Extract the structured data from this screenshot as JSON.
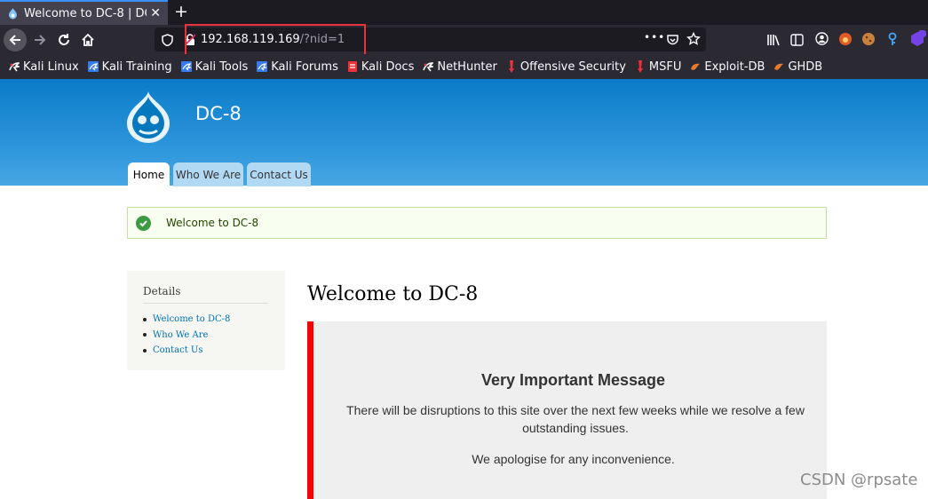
{
  "browser": {
    "tab_title": "Welcome to DC-8 | DC-",
    "tab_close": "✕",
    "new_tab": "+",
    "url_host": "192.168.119.169",
    "url_path": "/?nid=1",
    "url_menu": "•••",
    "highlight_color": "#e8323d"
  },
  "bookmarks": [
    {
      "label": "Kali Linux",
      "icon": "kali-dragon-icon"
    },
    {
      "label": "Kali Training",
      "icon": "kali-training-icon"
    },
    {
      "label": "Kali Tools",
      "icon": "kali-tools-icon"
    },
    {
      "label": "Kali Forums",
      "icon": "kali-forums-icon"
    },
    {
      "label": "Kali Docs",
      "icon": "kali-docs-icon"
    },
    {
      "label": "NetHunter",
      "icon": "nethunter-icon"
    },
    {
      "label": "Offensive Security",
      "icon": "offsec-icon"
    },
    {
      "label": "MSFU",
      "icon": "msfu-icon"
    },
    {
      "label": "Exploit-DB",
      "icon": "exploitdb-icon"
    },
    {
      "label": "GHDB",
      "icon": "ghdb-icon"
    }
  ],
  "site": {
    "name": "DC-8",
    "tabs": [
      {
        "label": "Home",
        "active": true
      },
      {
        "label": "Who We Are",
        "active": false
      },
      {
        "label": "Contact Us",
        "active": false
      }
    ],
    "status_message": "Welcome to DC-8"
  },
  "sidebar": {
    "title": "Details",
    "links": [
      "Welcome to DC-8",
      "Who We Are",
      "Contact Us"
    ]
  },
  "main": {
    "title": "Welcome to DC-8",
    "heading": "Very Important Message",
    "paragraph1": "There will be disruptions to this site over the next few weeks while we resolve a few outstanding issues.",
    "paragraph2": "We apologise for any inconvenience.",
    "accent_color": "#ff0000"
  },
  "watermark": "CSDN @rpsate"
}
